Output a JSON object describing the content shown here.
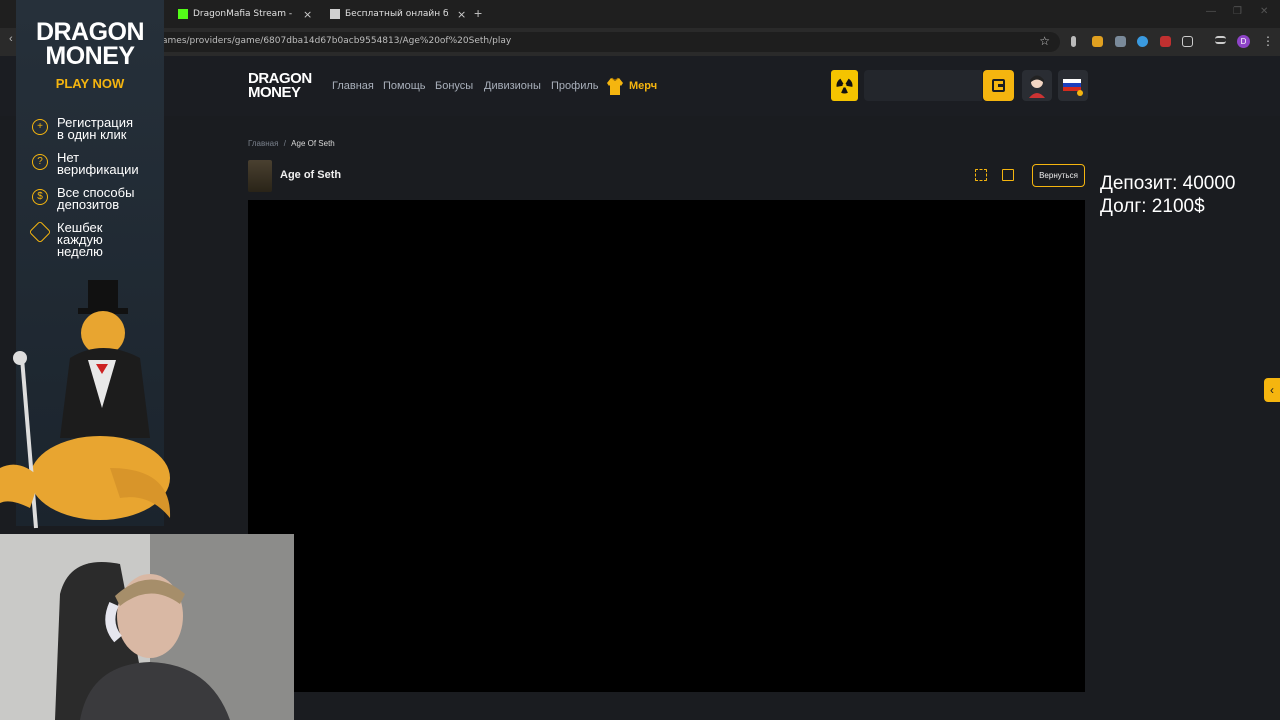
{
  "browser": {
    "tabs": [
      {
        "title": "DragonMafia Stream - Watch L",
        "close": "×"
      },
      {
        "title": "Бесплатный онлайн блокнот",
        "close": "×"
      }
    ],
    "new_tab": "+",
    "url": "ames/providers/game/6807dba14d67b0acb9554813/Age%20of%20Seth/play",
    "bookmark_star": "☆",
    "profile_initial": "D",
    "menu": "⋮"
  },
  "site": {
    "logo": "DRAGON\nMONEY",
    "nav": [
      "Главная",
      "Помощь",
      "Бонусы",
      "Дивизионы",
      "Профиль"
    ],
    "merch": "Мерч"
  },
  "breadcrumb": {
    "home": "Главная",
    "sep": "/",
    "current": "Age Of Seth"
  },
  "game": {
    "title": "Age of Seth",
    "back_button": "Вернуться"
  },
  "overlay": {
    "deposit": "Депозит: 40000",
    "debt": "Долг: 2100$"
  },
  "banner": {
    "title": "DRAGON\nMONEY",
    "cta": "PLAY NOW",
    "features": [
      {
        "icon": "plus-circle-icon",
        "label": "Регистрация\nв один клик"
      },
      {
        "icon": "question-circle-icon",
        "label": "Нет\nверификации"
      },
      {
        "icon": "coin-icon",
        "label": "Все способы\nдепозитов"
      },
      {
        "icon": "shield-check-icon",
        "label": "Кешбек\nкаждую\nнеделю"
      }
    ]
  },
  "colors": {
    "accent": "#f5b50f",
    "background": "#1a1c20",
    "game_bg": "#000000"
  }
}
